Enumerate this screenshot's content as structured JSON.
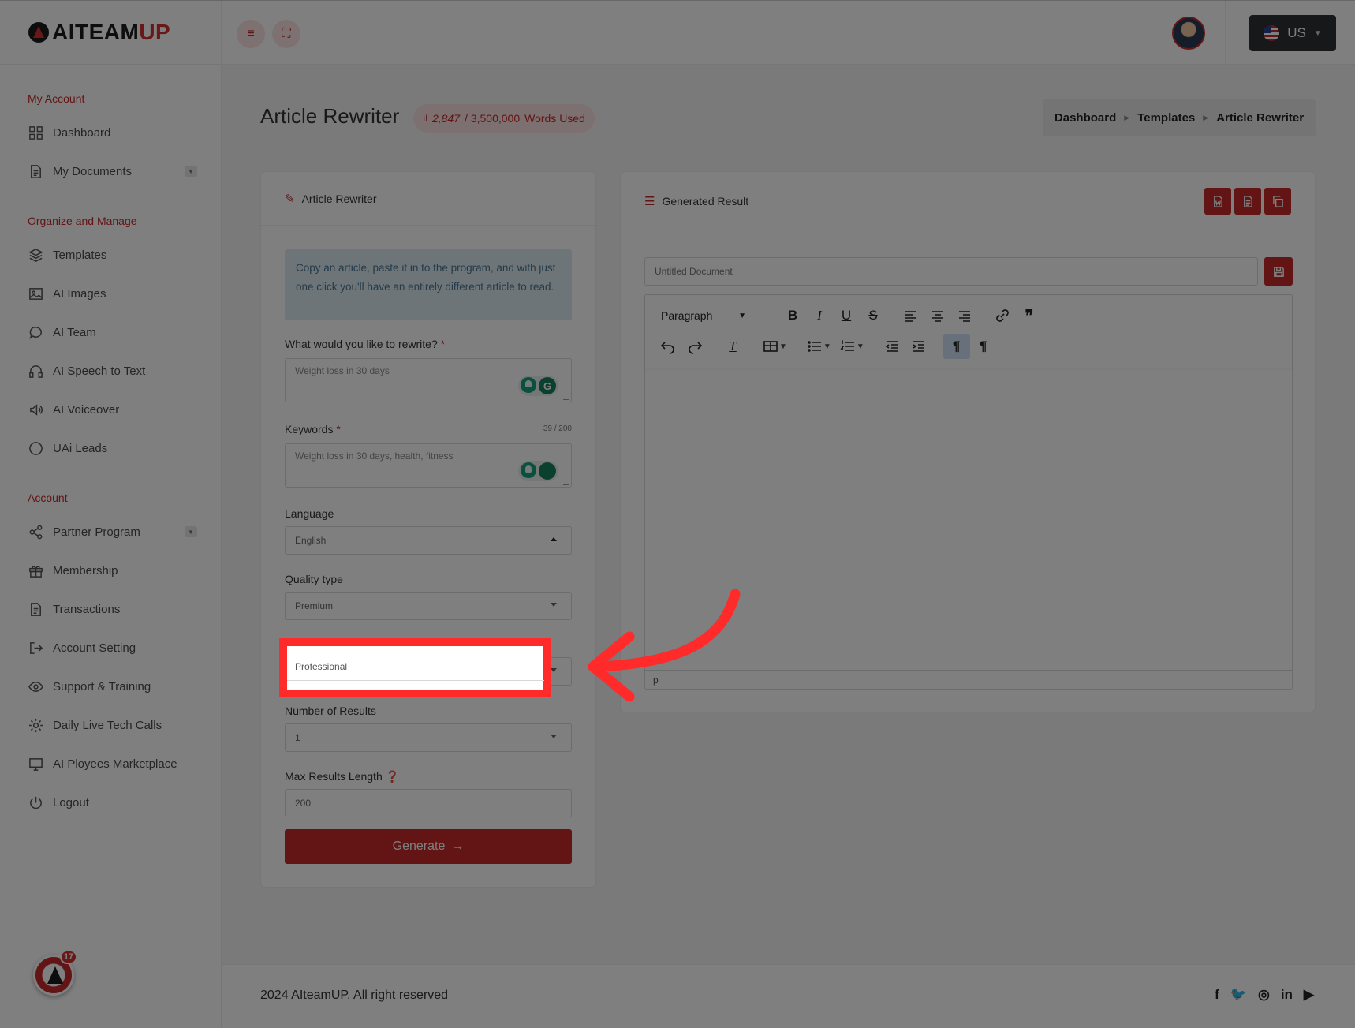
{
  "brand": {
    "logo_dark": "AITEAM",
    "logo_red": "UP"
  },
  "topbar": {
    "language_label": "US"
  },
  "sidebar": {
    "sections": [
      {
        "title": "My Account",
        "items": [
          {
            "label": "Dashboard",
            "icon": "grid-icon"
          },
          {
            "label": "My Documents",
            "icon": "document-icon",
            "expandable": true
          }
        ]
      },
      {
        "title": "Organize and Manage",
        "items": [
          {
            "label": "Templates",
            "icon": "layers-icon"
          },
          {
            "label": "AI Images",
            "icon": "image-icon"
          },
          {
            "label": "AI Team",
            "icon": "chat-icon"
          },
          {
            "label": "AI Speech to Text",
            "icon": "headphones-icon"
          },
          {
            "label": "AI Voiceover",
            "icon": "speaker-icon"
          },
          {
            "label": "UAi Leads",
            "icon": "circle-icon"
          }
        ]
      },
      {
        "title": "Account",
        "items": [
          {
            "label": "Partner Program",
            "icon": "share-icon",
            "expandable": true
          },
          {
            "label": "Membership",
            "icon": "gift-icon"
          },
          {
            "label": "Transactions",
            "icon": "receipt-icon"
          },
          {
            "label": "Account Setting",
            "icon": "exit-icon"
          },
          {
            "label": "Support & Training",
            "icon": "eye-icon"
          },
          {
            "label": "Daily Live Tech Calls",
            "icon": "gear-icon"
          },
          {
            "label": "AI Ployees Marketplace",
            "icon": "monitor-icon"
          },
          {
            "label": "Logout",
            "icon": "power-icon"
          }
        ]
      }
    ],
    "chat_badge": "17"
  },
  "page": {
    "title": "Article Rewriter",
    "usage": {
      "used": "2,847",
      "total": "/ 3,500,000",
      "suffix": "Words Used"
    },
    "breadcrumb": [
      "Dashboard",
      "Templates",
      "Article Rewriter"
    ]
  },
  "form": {
    "header": "Article Rewriter",
    "info": "Copy an article, paste it in to the program, and with just one click you'll have an entirely different article to read.",
    "rewrite_label": "What would you like to rewrite?",
    "rewrite_placeholder": "Weight loss in 30 days",
    "keywords_label": "Keywords",
    "keywords_counter": "39 / 200",
    "keywords_value": "Weight loss in 30 days, health, fitness",
    "language_label": "Language",
    "language_value": "English",
    "quality_label": "Quality type",
    "quality_value": "Premium",
    "tone_value": "Professional",
    "results_label": "Number of Results",
    "results_value": "1",
    "maxlen_label": "Max Results Length",
    "maxlen_value": "200",
    "generate_label": "Generate"
  },
  "result": {
    "header": "Generated Result",
    "doc_placeholder": "Untitled Document",
    "block_format": "Paragraph",
    "status_path": "p"
  },
  "footer": {
    "copyright": "2024 AIteamUP, All right reserved"
  }
}
